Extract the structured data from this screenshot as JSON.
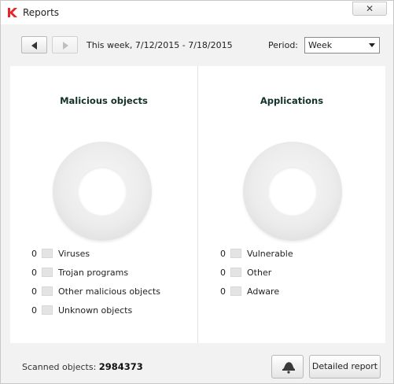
{
  "window": {
    "title": "Reports",
    "close_label": "✕"
  },
  "toolbar": {
    "prev_icon": "arrow-left-icon",
    "next_icon": "arrow-right-icon",
    "date_range": "This week, 7/12/2015 - 7/18/2015",
    "period_label": "Period:",
    "period_value": "Week"
  },
  "panels": {
    "malicious": {
      "title": "Malicious objects",
      "items": [
        {
          "count": "0",
          "label": "Viruses"
        },
        {
          "count": "0",
          "label": "Trojan programs"
        },
        {
          "count": "0",
          "label": "Other malicious objects"
        },
        {
          "count": "0",
          "label": "Unknown objects"
        }
      ]
    },
    "applications": {
      "title": "Applications",
      "items": [
        {
          "count": "0",
          "label": "Vulnerable"
        },
        {
          "count": "0",
          "label": "Other"
        },
        {
          "count": "0",
          "label": "Adware"
        }
      ]
    }
  },
  "footer": {
    "scanned_label": "Scanned objects:",
    "scanned_value": "2984373",
    "notify_icon": "bell-icon",
    "detail_button": "Detailed report"
  },
  "colors": {
    "brand": "#e2262a",
    "panel_title": "#14322c"
  }
}
